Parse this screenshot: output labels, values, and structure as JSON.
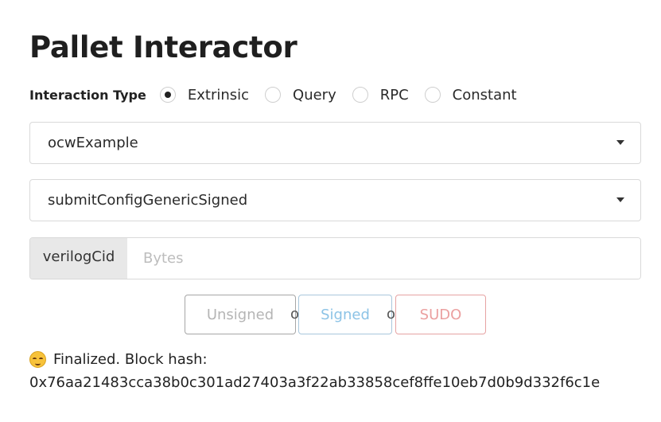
{
  "page": {
    "title": "Pallet Interactor"
  },
  "interaction_type": {
    "label": "Interaction Type",
    "options": [
      {
        "label": "Extrinsic",
        "checked": true
      },
      {
        "label": "Query",
        "checked": false
      },
      {
        "label": "RPC",
        "checked": false
      },
      {
        "label": "Constant",
        "checked": false
      }
    ]
  },
  "pallet_select": {
    "value": "ocwExample"
  },
  "call_select": {
    "value": "submitConfigGenericSigned"
  },
  "param": {
    "label": "verilogCid",
    "placeholder": "Bytes",
    "value": ""
  },
  "actions": {
    "unsigned_label": "Unsigned",
    "or1": "or",
    "signed_label": "Signed",
    "or2": "or",
    "sudo_label": "SUDO",
    "colors": {
      "unsigned": "#b5b5b5",
      "signed": "#8cc3e6",
      "sudo": "#eba0a0"
    }
  },
  "status": {
    "icon": "grinning-sweat-emoji-icon",
    "text": "Finalized. Block hash:",
    "hash": "0x76aa21483cca38b0c301ad27403a3f22ab33858cef8ffe10eb7d0b9d332f6c1e"
  }
}
